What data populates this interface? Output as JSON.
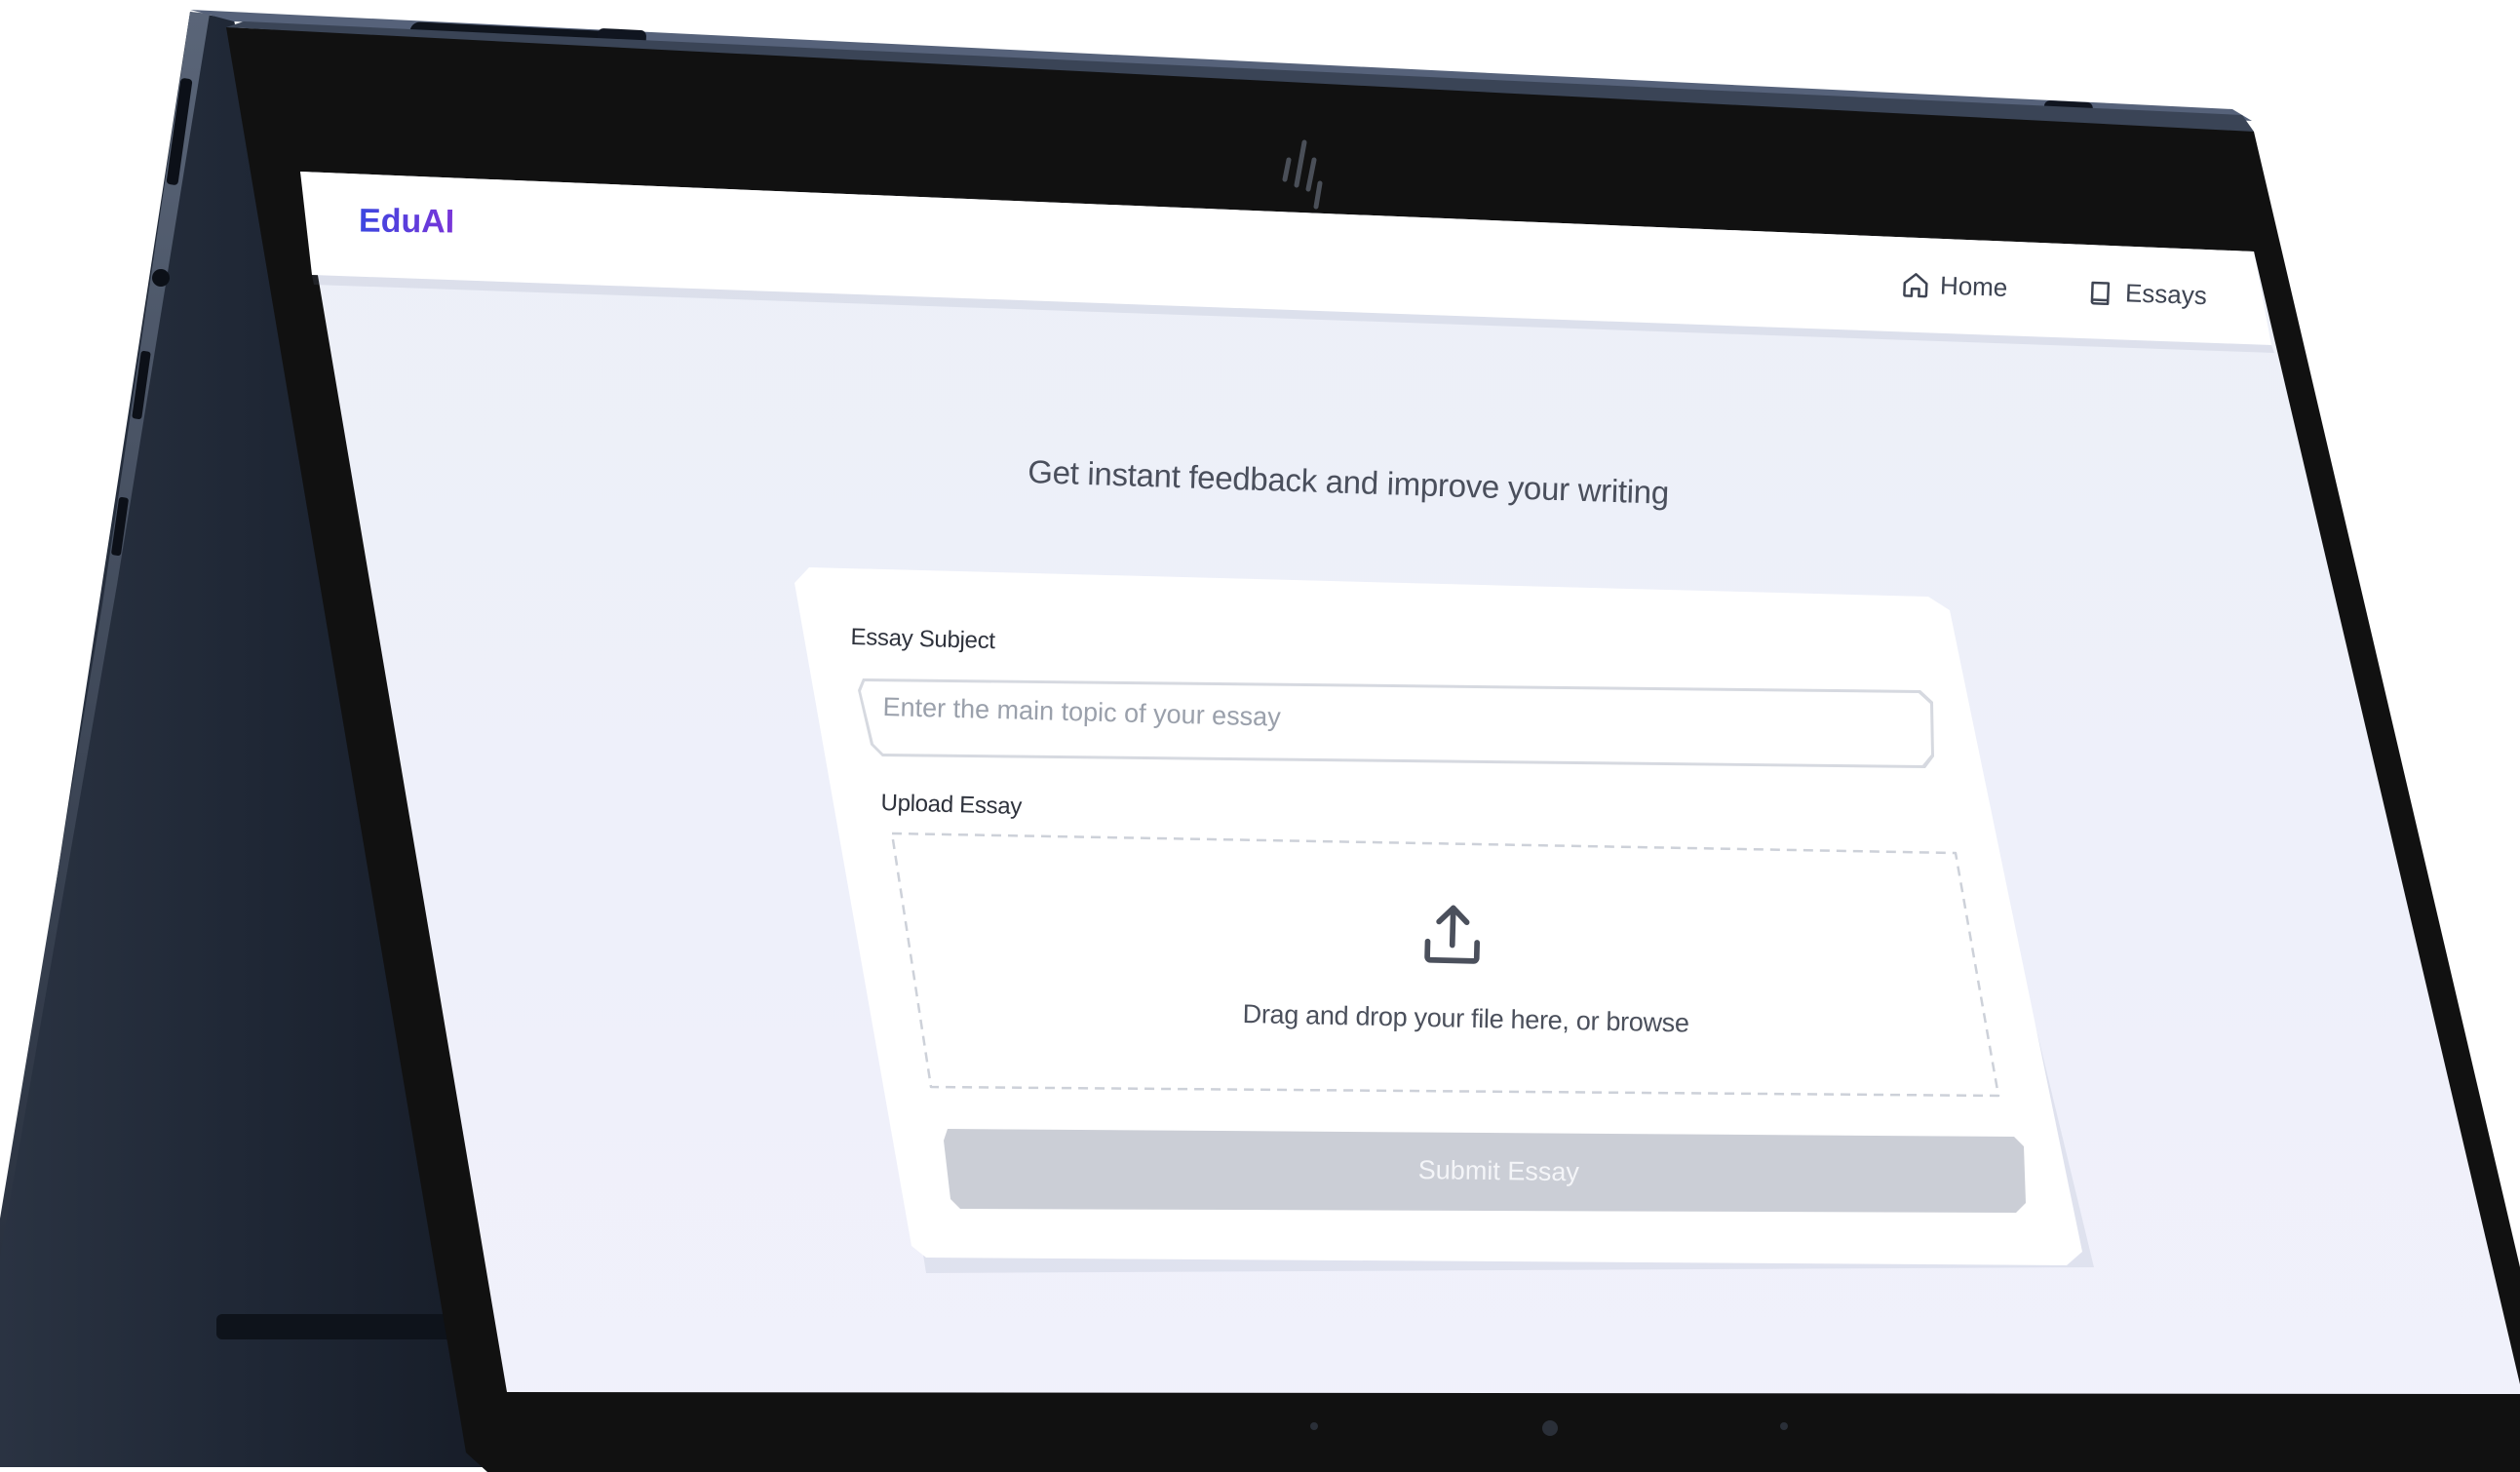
{
  "app": {
    "logo": "EduAI"
  },
  "nav": {
    "items": [
      {
        "label": "Home",
        "icon": "home-icon"
      },
      {
        "label": "Essays",
        "icon": "book-icon"
      }
    ]
  },
  "main": {
    "headline": "Get instant feedback and improve your writing",
    "form": {
      "subject_label": "Essay Subject",
      "subject_placeholder": "Enter the main topic of your essay",
      "subject_value": "",
      "upload_label": "Upload Essay",
      "upload_icon": "upload-icon",
      "dropzone_text": "Drag and drop your file here, or browse",
      "submit_label": "Submit Essay",
      "submit_enabled": false
    }
  },
  "device": {
    "brand_mark": "hp-logo-icon"
  },
  "colors": {
    "logo_gradient_start": "#3b47e0",
    "logo_gradient_end": "#7a35d8",
    "page_background": "#eef0f8",
    "submit_disabled": "#cbced6",
    "device_body": "#1d2533",
    "bezel": "#111111"
  }
}
